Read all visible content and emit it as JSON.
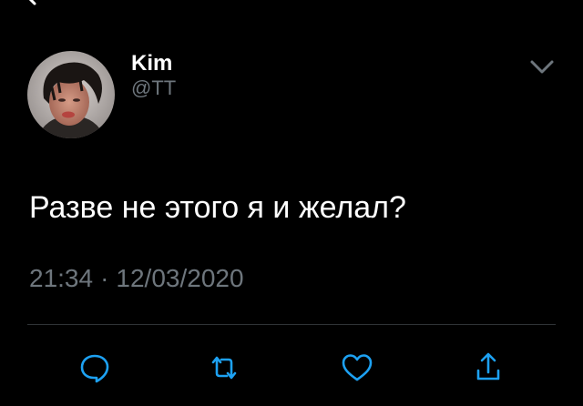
{
  "tweet": {
    "author": {
      "display_name": "Kim",
      "handle": "@TT"
    },
    "text": "Разве не этого я и желал?",
    "time": "21:34",
    "separator": "·",
    "date": "12/03/2020"
  },
  "icons": {
    "top_left": "back-arrow-icon",
    "caret": "chevron-down-icon",
    "reply": "reply-icon",
    "retweet": "retweet-icon",
    "like": "heart-icon",
    "share": "share-icon"
  },
  "colors": {
    "background": "#000000",
    "primary_text": "#ffffff",
    "secondary_text": "#6e767d",
    "icon": "#1da1f2",
    "divider": "#2f3336"
  }
}
